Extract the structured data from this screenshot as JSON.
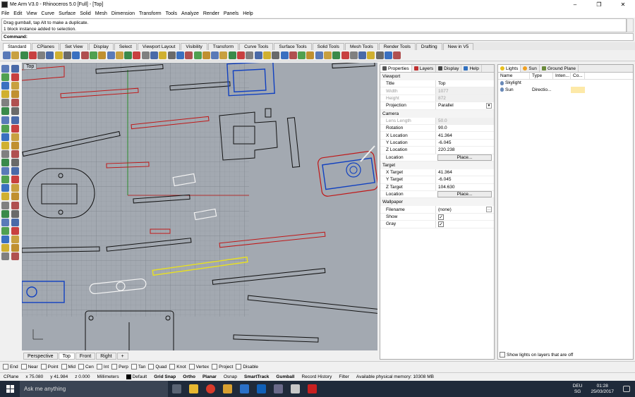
{
  "window": {
    "title": "Me Arm V3.0 - Rhinoceros 5.0 [Full] - [Top]",
    "min": "–",
    "max": "❐",
    "close": "✕"
  },
  "menu": [
    "File",
    "Edit",
    "View",
    "Curve",
    "Surface",
    "Solid",
    "Mesh",
    "Dimension",
    "Transform",
    "Tools",
    "Analyze",
    "Render",
    "Panels",
    "Help"
  ],
  "command_history": [
    "Drag gumball, tap Alt to make a duplicate.",
    "1 block instance added to selection."
  ],
  "command_prompt": "Command:",
  "toolbar_tabs": [
    "Standard",
    "CPlanes",
    "Set View",
    "Display",
    "Select",
    "Viewport Layout",
    "Visibility",
    "Transform",
    "Curve Tools",
    "Surface Tools",
    "Solid Tools",
    "Mesh Tools",
    "Render Tools",
    "Drafting",
    "New in V5"
  ],
  "viewport": {
    "label": "Top",
    "tabs": [
      "Perspective",
      "Top",
      "Front",
      "Right",
      "+"
    ],
    "active_tab": "Top"
  },
  "osnaps": [
    {
      "label": "End",
      "checked": false
    },
    {
      "label": "Near",
      "checked": false
    },
    {
      "label": "Point",
      "checked": false
    },
    {
      "label": "Mid",
      "checked": false
    },
    {
      "label": "Cen",
      "checked": false
    },
    {
      "label": "Int",
      "checked": false
    },
    {
      "label": "Perp",
      "checked": false
    },
    {
      "label": "Tan",
      "checked": false
    },
    {
      "label": "Quad",
      "checked": false
    },
    {
      "label": "Knot",
      "checked": false
    },
    {
      "label": "Vertex",
      "checked": false
    },
    {
      "label": "Project",
      "checked": false
    },
    {
      "label": "Disable",
      "checked": false
    }
  ],
  "status": {
    "cplane": "CPlane",
    "x": "x 75.080",
    "y": "y 41.984",
    "z": "z 0.000",
    "units": "Millimeters",
    "layer": "Default",
    "grid_snap": "Grid Snap",
    "ortho": "Ortho",
    "planar": "Planar",
    "osnap": "Osnap",
    "smarttrack": "SmartTrack",
    "gumball": "Gumball",
    "record_history": "Record History",
    "filter": "Filter",
    "memory": "Available physical memory: 10308 MB"
  },
  "properties_tabs": [
    "Properties",
    "Layers",
    "Display",
    "Help"
  ],
  "properties": {
    "viewport_section": "Viewport",
    "title_label": "Title",
    "title_value": "Top",
    "width_label": "Width",
    "width_value": "1077",
    "height_label": "Height",
    "height_value": "872",
    "projection_label": "Projection",
    "projection_value": "Parallel",
    "camera_section": "Camera",
    "lens_label": "Lens Length",
    "lens_value": "50.0",
    "rotation_label": "Rotation",
    "rotation_value": "90.0",
    "xloc_label": "X Location",
    "xloc_value": "41.364",
    "yloc_label": "Y Location",
    "yloc_value": "-6.045",
    "zloc_label": "Z Location",
    "zloc_value": "220.238",
    "location_label": "Location",
    "place_button": "Place...",
    "target_section": "Target",
    "xt_label": "X Target",
    "xt_value": "41.364",
    "yt_label": "Y Target",
    "yt_value": "-6.045",
    "zt_label": "Z Target",
    "zt_value": "104.630",
    "tlocation_label": "Location",
    "tplace_button": "Place...",
    "wallpaper_section": "Wallpaper",
    "filename_label": "Filename",
    "filename_value": "(none)",
    "show_label": "Show",
    "show_checked": true,
    "gray_label": "Gray",
    "gray_checked": true,
    "browse": "..."
  },
  "lights_tabs": [
    "Lights",
    "Sun",
    "Ground Plane"
  ],
  "lights": {
    "columns": [
      "Name",
      "Type",
      "Inten...",
      "Co..."
    ],
    "rows": [
      {
        "name": "Skylight",
        "type": "",
        "intensity": "",
        "color": ""
      },
      {
        "name": "Sun",
        "type": "Directio...",
        "intensity": "",
        "color": ""
      }
    ],
    "footer": "Show lights on layers that are off"
  },
  "taskbar": {
    "search": "Ask me anything",
    "lang_top": "DEU",
    "lang_bottom": "SG",
    "time": "01:28",
    "date": "25/03/2017"
  }
}
